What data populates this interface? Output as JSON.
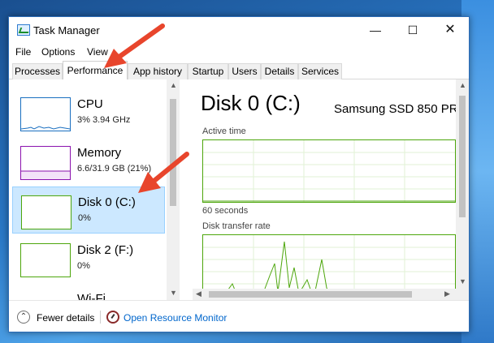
{
  "window": {
    "title": "Task Manager",
    "controls": {
      "minimize": "—",
      "maximize": "☐",
      "close": "✕"
    }
  },
  "menu": [
    "File",
    "Options",
    "View"
  ],
  "tabs": [
    "Processes",
    "Performance",
    "App history",
    "Startup",
    "Users",
    "Details",
    "Services"
  ],
  "active_tab": "Performance",
  "sidebar": {
    "items": [
      {
        "name": "CPU",
        "detail": "3% 3.94 GHz",
        "color": "#1a6fc0"
      },
      {
        "name": "Memory",
        "detail": "6.6/31.9 GB (21%)",
        "color": "#8b12ae"
      },
      {
        "name": "Disk 0 (C:)",
        "detail": "0%",
        "color": "#4da60c",
        "selected": true
      },
      {
        "name": "Disk 2 (F:)",
        "detail": "0%",
        "color": "#4da60c"
      },
      {
        "name": "Wi-Fi",
        "detail": ""
      }
    ]
  },
  "detail": {
    "title": "Disk 0 (C:)",
    "model": "Samsung SSD 850 PR",
    "graph1_label": "Active time",
    "graph1_time": "60 seconds",
    "graph2_label": "Disk transfer rate",
    "graph_color": "#4da60c"
  },
  "footer": {
    "fewer_details": "Fewer details",
    "open_resource_monitor": "Open Resource Monitor"
  },
  "colors": {
    "accent": "#0066cc",
    "selected_bg": "#cce8ff",
    "callout_arrow": "#e8452c"
  }
}
